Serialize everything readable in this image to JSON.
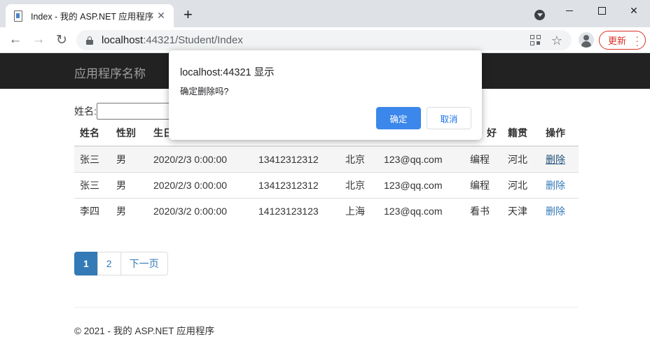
{
  "browser": {
    "tab_title": "Index - 我的 ASP.NET 应用程序",
    "url_host": "localhost",
    "url_rest": ":44321/Student/Index",
    "update_label": "更新"
  },
  "navbar": {
    "brand": "应用程序名称"
  },
  "search": {
    "label": "姓名:",
    "value": ""
  },
  "table": {
    "headers": [
      "姓名",
      "性别",
      "生日",
      "",
      "",
      "",
      "好",
      "籍贯",
      "操作"
    ],
    "rows": [
      [
        "张三",
        "男",
        "2020/2/3 0:00:00",
        "13412312312",
        "北京",
        "123@qq.com",
        "编程",
        "河北",
        "删除"
      ],
      [
        "张三",
        "男",
        "2020/2/3 0:00:00",
        "13412312312",
        "北京",
        "123@qq.com",
        "编程",
        "河北",
        "删除"
      ],
      [
        "李四",
        "男",
        "2020/3/2 0:00:00",
        "14123123123",
        "上海",
        "123@qq.com",
        "看书",
        "天津",
        "删除"
      ]
    ]
  },
  "pagination": {
    "pages": [
      "1",
      "2"
    ],
    "next": "下一页",
    "active": "1"
  },
  "footer": {
    "text": "© 2021 - 我的 ASP.NET 应用程序"
  },
  "dialog": {
    "title": "localhost:44321 显示",
    "message": "确定删除吗?",
    "ok": "确定",
    "cancel": "取消"
  }
}
